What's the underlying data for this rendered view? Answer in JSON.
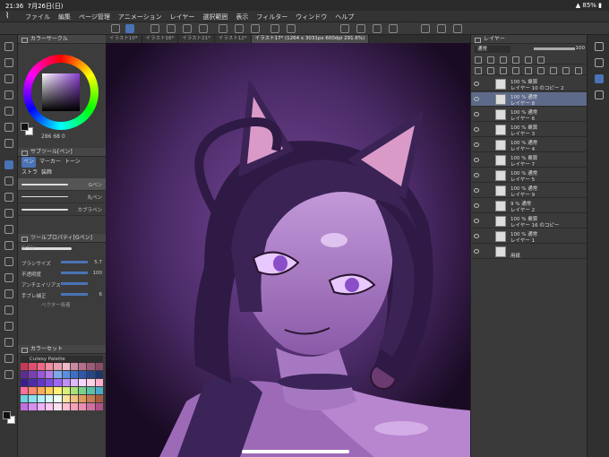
{
  "status": {
    "time": "21:36",
    "date": "7月26日(日)",
    "battery": "85%"
  },
  "menu": [
    "ファイル",
    "編集",
    "ページ管理",
    "アニメーション",
    "レイヤー",
    "選択範囲",
    "表示",
    "フィルター",
    "ウィンドウ",
    "ヘルプ"
  ],
  "tabs": [
    "イラスト10*",
    "イラスト16*",
    "イラスト21*",
    "イラスト12*",
    "イラスト17* (1264 x 3031px 600dpi 291.6%)"
  ],
  "color_panel": {
    "title": "カラーサークル",
    "info": "286 68 0"
  },
  "subtool": {
    "title": "サブツール[ペン]",
    "groups": [
      "ペン",
      "マーカー",
      "トーン"
    ],
    "groups2": [
      "ストラ",
      "装飾"
    ],
    "brushes": [
      "Gペン",
      "丸ペン",
      "カブラペン"
    ]
  },
  "tool_property": {
    "title": "ツールプロパティ[Gペン]",
    "brush_name": "Gペン",
    "props": [
      {
        "k": "ブラシサイズ",
        "n": "5.7"
      },
      {
        "k": "不透明度",
        "n": "100"
      },
      {
        "k": "アンチエイリアス",
        "n": ""
      },
      {
        "k": "手ブレ補正",
        "n": "6"
      }
    ],
    "vector": "ベクター吸着"
  },
  "colorset": {
    "title": "カラーセット",
    "palette_name": "Cutesy Palette",
    "colors": [
      "#c53a5a",
      "#e04f6f",
      "#f06a86",
      "#f28ca0",
      "#e8a0b0",
      "#f0b8c6",
      "#c98aa0",
      "#b46f8a",
      "#a05b78",
      "#8a4a66",
      "#5b2d8f",
      "#7a3fb5",
      "#9a58d6",
      "#b77be8",
      "#7da9ea",
      "#5a8fe0",
      "#3d6fc8",
      "#2e57a8",
      "#25468a",
      "#1d356b",
      "#3a1f8a",
      "#4d2bab",
      "#6236c8",
      "#7b4be0",
      "#9c68f0",
      "#c090f8",
      "#e0b8ff",
      "#f2d6ff",
      "#ffd0e8",
      "#ffb0d0",
      "#ff6f9a",
      "#ff8a6f",
      "#ffaa5a",
      "#ffd05a",
      "#fff07a",
      "#d8f07a",
      "#a8e07a",
      "#7ad08a",
      "#5ac0a8",
      "#4aa8c8",
      "#6fd0e0",
      "#8ae0f0",
      "#b0f0ff",
      "#d6f8ff",
      "#f0fff8",
      "#f8e0a0",
      "#f0c080",
      "#e09a60",
      "#c87a50",
      "#a85a40",
      "#c070e0",
      "#d890f0",
      "#f0b0f8",
      "#ffc8f0",
      "#ffe0f0",
      "#ffc0d0",
      "#f8a0b8",
      "#e890b0",
      "#d070a0",
      "#b05088"
    ]
  },
  "layer_panel": {
    "title": "レイヤー",
    "blend": "通常",
    "opacity": "100",
    "layers": [
      {
        "t1": "100 % 乗算",
        "t2": "レイヤー 10 のコピー 2",
        "sel": false
      },
      {
        "t1": "100 % 通常",
        "t2": "レイヤー 8",
        "sel": true
      },
      {
        "t1": "100 % 通常",
        "t2": "レイヤー 6",
        "sel": false
      },
      {
        "t1": "100 % 乗算",
        "t2": "レイヤー 3",
        "sel": false
      },
      {
        "t1": "100 % 通常",
        "t2": "レイヤー 4",
        "sel": false
      },
      {
        "t1": "100 % 乗算",
        "t2": "レイヤー 7",
        "sel": false
      },
      {
        "t1": "100 % 通常",
        "t2": "レイヤー 5",
        "sel": false
      },
      {
        "t1": "100 % 通常",
        "t2": "レイヤー 9",
        "sel": false
      },
      {
        "t1": "9 % 通常",
        "t2": "レイヤー 2",
        "sel": false
      },
      {
        "t1": "100 % 乗算",
        "t2": "レイヤー 16 のコピー",
        "sel": false
      },
      {
        "t1": "100 % 通常",
        "t2": "レイヤー 1",
        "sel": false
      },
      {
        "t1": "",
        "t2": "用紙",
        "sel": false
      }
    ]
  },
  "colors": {
    "accent": "#4a73b5",
    "canvas_bg": "#1f1029",
    "skin": "#b58ac9",
    "hair": "#3b2355"
  }
}
